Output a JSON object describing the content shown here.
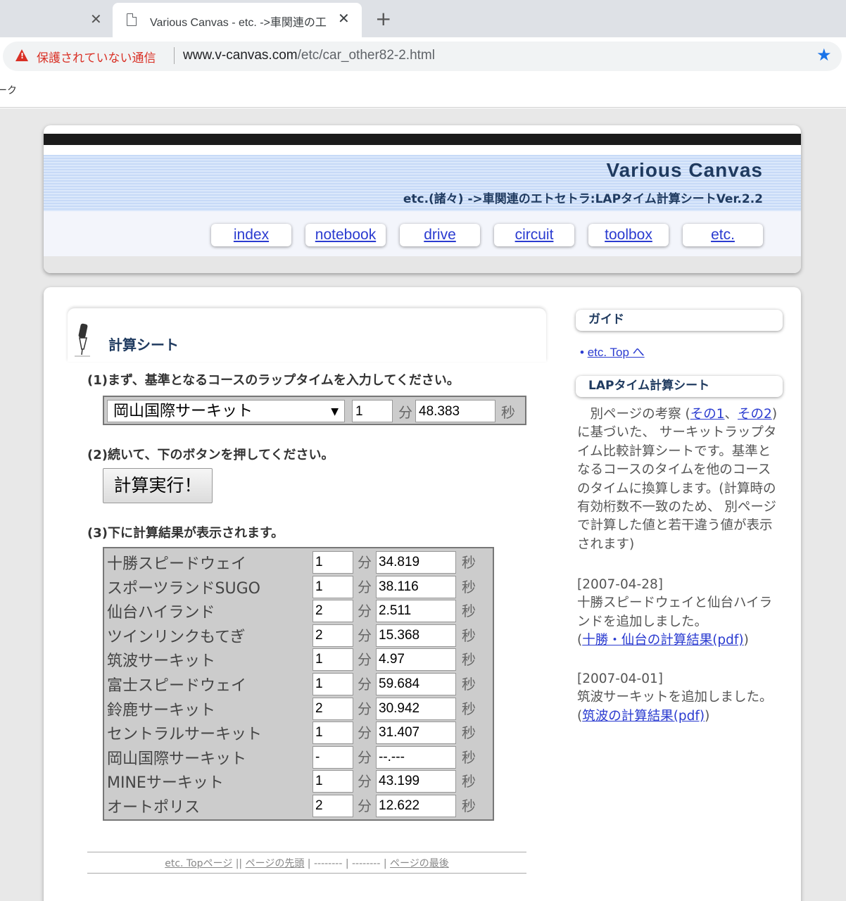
{
  "browser": {
    "tab_title": "Various Canvas - etc. ->車関連の工",
    "security_label": "保護されていない通信",
    "url_host": "www.v-canvas.com",
    "url_path": "/etc/car_other82-2.html",
    "bookmark_fragment": "ーク"
  },
  "header": {
    "site_title": "Various Canvas",
    "subtitle": "etc.(諸々) ->車関連のエトセトラ:LAPタイム計算シートVer.2.2",
    "nav": [
      "index",
      "notebook",
      "drive",
      "circuit",
      "toolbox",
      "etc."
    ]
  },
  "main": {
    "section_title": "計算シート",
    "step1": "(1)まず、基準となるコースのラップタイムを入力してください。",
    "course_select": "岡山国際サーキット",
    "base_min": "1",
    "base_sec": "48.383",
    "min_unit": "分",
    "sec_unit": "秒",
    "step2": "(2)続いて、下のボタンを押してください。",
    "calc_button": "計算実行！",
    "step3": "(3)下に計算結果が表示されます。",
    "results": [
      {
        "name": "十勝スピードウェイ",
        "min": "1",
        "sec": "34.819"
      },
      {
        "name": "スポーツランドSUGO",
        "min": "1",
        "sec": "38.116"
      },
      {
        "name": "仙台ハイランド",
        "min": "2",
        "sec": "2.511"
      },
      {
        "name": "ツインリンクもてぎ",
        "min": "2",
        "sec": "15.368"
      },
      {
        "name": "筑波サーキット",
        "min": "1",
        "sec": "4.97"
      },
      {
        "name": "富士スピードウェイ",
        "min": "1",
        "sec": "59.684"
      },
      {
        "name": "鈴鹿サーキット",
        "min": "2",
        "sec": "30.942"
      },
      {
        "name": "セントラルサーキット",
        "min": "1",
        "sec": "31.407"
      },
      {
        "name": "岡山国際サーキット",
        "min": "-",
        "sec": "--.---"
      },
      {
        "name": "MINEサーキット",
        "min": "1",
        "sec": "43.199"
      },
      {
        "name": "オートポリス",
        "min": "2",
        "sec": "12.622"
      }
    ],
    "footer": {
      "top_link": "etc. Topページ",
      "sep1": " || ",
      "head_link": "ページの先頭",
      "mid": " | -------- | -------- | ",
      "last_link": "ページの最後"
    }
  },
  "sidebar": {
    "guide_title": "ガイド",
    "guide_link": "etc. Top へ",
    "lap_title": "LAPタイム計算シート",
    "desc_pre": "　別ページの考察 (",
    "desc_link1": "その1",
    "desc_mid": "、",
    "desc_link2": "その2",
    "desc_post": ") に基づいた、 サーキットラップタイム比較計算シートです。基準となるコースのタイムを他のコースのタイムに換算します。(計算時の有効桁数不一致のため、 別ページで計算した値と若干違う値が表示されます)",
    "news1_date": "[2007-04-28]",
    "news1_text": "十勝スピードウェイと仙台ハイランドを追加しました。",
    "news1_link": "十勝・仙台の計算結果(pdf)",
    "news2_date": "[2007-04-01]",
    "news2_text": "筑波サーキットを追加しました。",
    "news2_link": "筑波の計算結果(pdf)"
  }
}
